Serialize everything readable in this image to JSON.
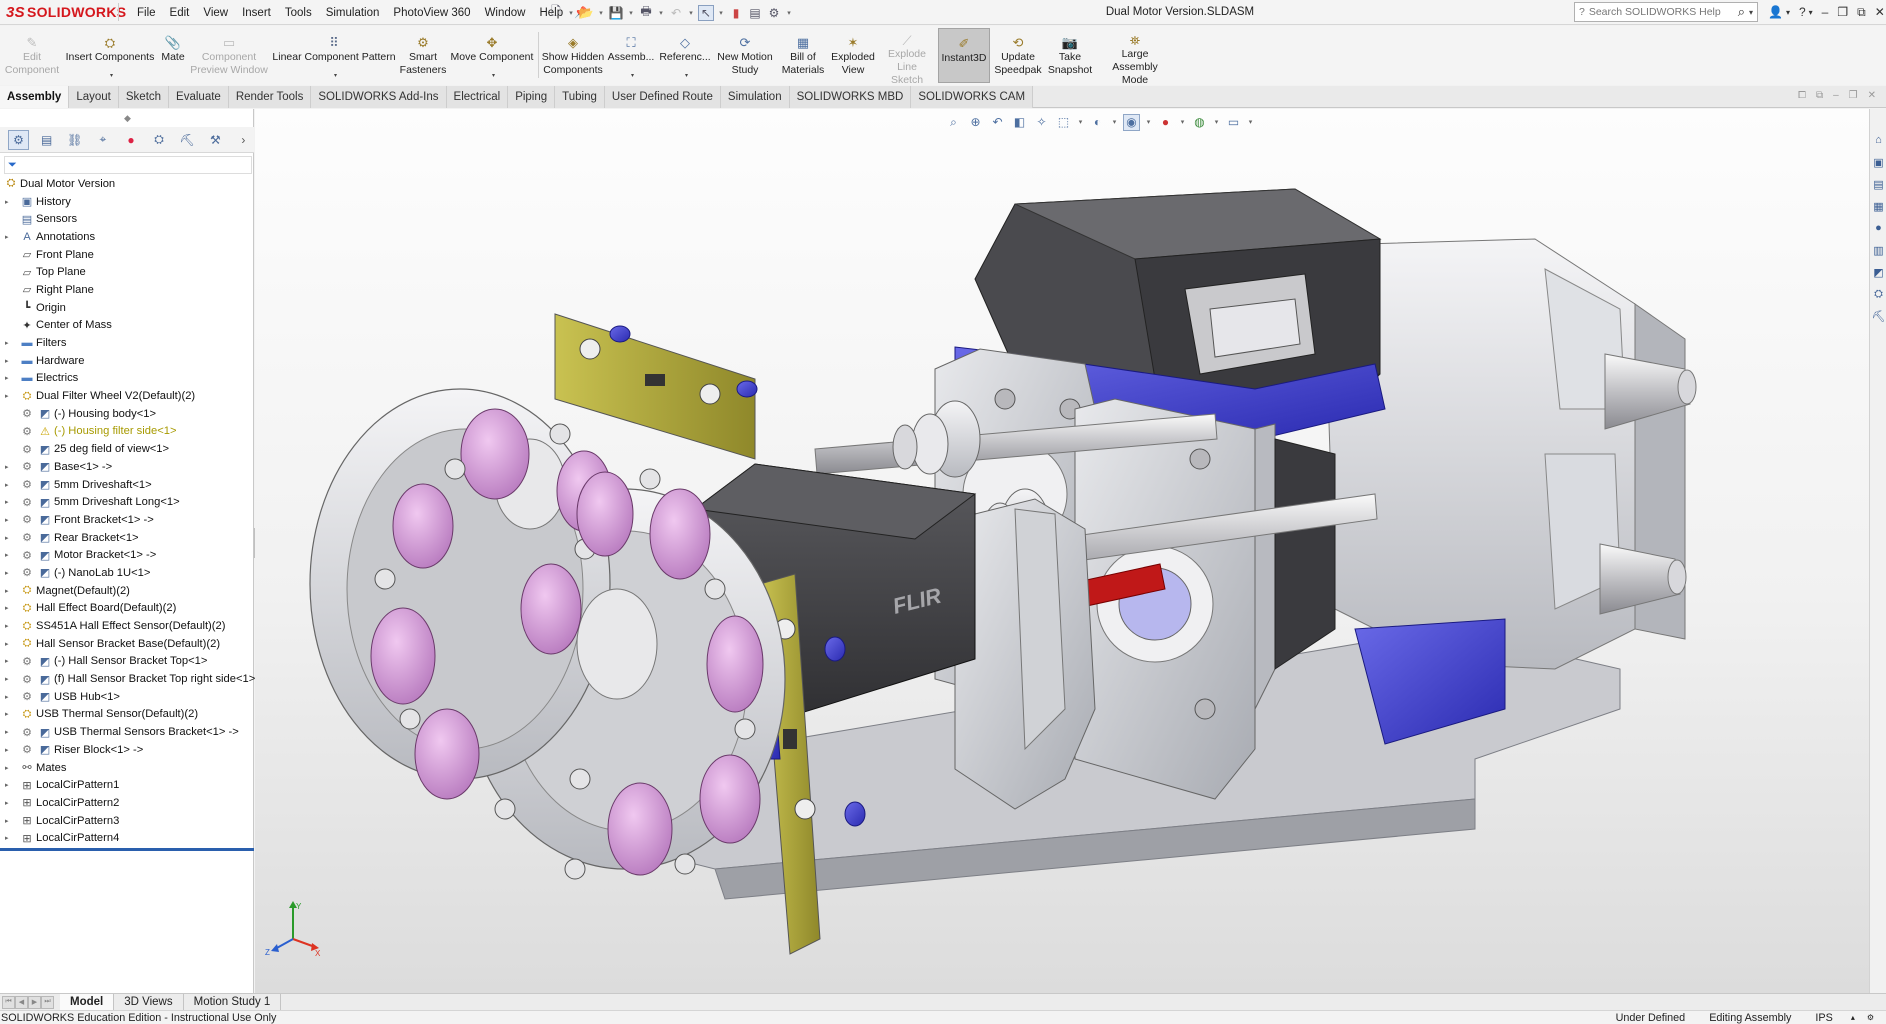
{
  "app": {
    "logo_brand": "SOLIDWORKS",
    "logo_mark": "3S",
    "document_title": "Dual Motor Version.SLDASM"
  },
  "menu": [
    "File",
    "Edit",
    "View",
    "Insert",
    "Tools",
    "Simulation",
    "PhotoView 360",
    "Window",
    "Help"
  ],
  "search": {
    "placeholder": "Search SOLIDWORKS Help"
  },
  "command_manager": {
    "edit_component": "Edit\nComponent",
    "insert_components": "Insert Components",
    "mate": "Mate",
    "component_preview": "Component\nPreview Window",
    "linear_pattern": "Linear Component Pattern",
    "smart_fasteners": "Smart\nFasteners",
    "move_component": "Move Component",
    "show_hidden": "Show Hidden\nComponents",
    "assembly_features": "Assemb...",
    "reference_geometry": "Referenc...",
    "new_motion_study": "New Motion\nStudy",
    "bill_of_materials": "Bill of\nMaterials",
    "exploded_view": "Exploded\nView",
    "explode_line_sketch": "Explode\nLine Sketch",
    "instant3d": "Instant3D",
    "update_speedpak": "Update\nSpeedpak",
    "take_snapshot": "Take\nSnapshot",
    "large_assembly_mode": "Large Assembly\nMode"
  },
  "tabs": [
    "Assembly",
    "Layout",
    "Sketch",
    "Evaluate",
    "Render Tools",
    "SOLIDWORKS Add-Ins",
    "Electrical",
    "Piping",
    "Tubing",
    "User Defined Route",
    "Simulation",
    "SOLIDWORKS MBD",
    "SOLIDWORKS CAM"
  ],
  "active_tab": "Assembly",
  "tree": [
    {
      "label": "Dual Motor Version",
      "icon": "assembly-icon",
      "level": 0,
      "expand": false
    },
    {
      "label": "History",
      "icon": "history-icon",
      "level": 1,
      "expand": true
    },
    {
      "label": "Sensors",
      "icon": "sensors-icon",
      "level": 1,
      "expand": false
    },
    {
      "label": "Annotations",
      "icon": "annotations-icon",
      "level": 1,
      "expand": true
    },
    {
      "label": "Front Plane",
      "icon": "plane-icon",
      "level": 1,
      "expand": false
    },
    {
      "label": "Top Plane",
      "icon": "plane-icon",
      "level": 1,
      "expand": false
    },
    {
      "label": "Right Plane",
      "icon": "plane-icon",
      "level": 1,
      "expand": false
    },
    {
      "label": "Origin",
      "icon": "origin-icon",
      "level": 1,
      "expand": false
    },
    {
      "label": "Center of Mass",
      "icon": "center-of-mass-icon",
      "level": 1,
      "expand": false
    },
    {
      "label": "Filters",
      "icon": "folder-icon",
      "level": 1,
      "expand": true
    },
    {
      "label": "Hardware",
      "icon": "folder-icon",
      "level": 1,
      "expand": true
    },
    {
      "label": "Electrics",
      "icon": "folder-icon",
      "level": 1,
      "expand": true
    },
    {
      "label": "Dual Filter Wheel V2(Default)(2)",
      "icon": "subassembly-icon",
      "level": 1,
      "expand": true
    },
    {
      "label": "(-) Housing body<1>",
      "icon": "part-icon",
      "level": 2,
      "expand": false
    },
    {
      "label": "(-) Housing filter side<1>",
      "icon": "warning-icon",
      "level": 2,
      "expand": false,
      "warn": true
    },
    {
      "label": "25 deg field of view<1>",
      "icon": "part-icon",
      "level": 2,
      "expand": false
    },
    {
      "label": "Base<1> ->",
      "icon": "part-icon",
      "level": 2,
      "expand": true
    },
    {
      "label": "5mm Driveshaft<1>",
      "icon": "part-icon",
      "level": 2,
      "expand": true
    },
    {
      "label": "5mm Driveshaft Long<1>",
      "icon": "part-icon",
      "level": 2,
      "expand": true
    },
    {
      "label": "Front Bracket<1> ->",
      "icon": "part-icon",
      "level": 2,
      "expand": true
    },
    {
      "label": "Rear Bracket<1>",
      "icon": "part-icon",
      "level": 2,
      "expand": true
    },
    {
      "label": "Motor Bracket<1> ->",
      "icon": "part-icon",
      "level": 2,
      "expand": true
    },
    {
      "label": "(-) NanoLab 1U<1>",
      "icon": "part-icon",
      "level": 2,
      "expand": true
    },
    {
      "label": "Magnet(Default)(2)",
      "icon": "subassembly-icon",
      "level": 1,
      "expand": true
    },
    {
      "label": "Hall Effect Board(Default)(2)",
      "icon": "subassembly-icon",
      "level": 1,
      "expand": true
    },
    {
      "label": "SS451A Hall Effect Sensor(Default)(2)",
      "icon": "subassembly-icon",
      "level": 1,
      "expand": true
    },
    {
      "label": "Hall Sensor Bracket Base(Default)(2)",
      "icon": "subassembly-icon",
      "level": 1,
      "expand": true
    },
    {
      "label": "(-) Hall Sensor Bracket Top<1>",
      "icon": "part-icon",
      "level": 2,
      "expand": true
    },
    {
      "label": "(f) Hall Sensor Bracket Top right side<1>",
      "icon": "part-icon",
      "level": 2,
      "expand": true
    },
    {
      "label": "USB Hub<1>",
      "icon": "part-icon",
      "level": 2,
      "expand": true
    },
    {
      "label": "USB Thermal Sensor(Default)(2)",
      "icon": "subassembly-icon",
      "level": 1,
      "expand": true
    },
    {
      "label": "USB Thermal Sensors Bracket<1> ->",
      "icon": "part-icon",
      "level": 2,
      "expand": true
    },
    {
      "label": "Riser Block<1> ->",
      "icon": "part-icon",
      "level": 2,
      "expand": true
    },
    {
      "label": "Mates",
      "icon": "mates-icon",
      "level": 1,
      "expand": true
    },
    {
      "label": "LocalCirPattern1",
      "icon": "pattern-icon",
      "level": 1,
      "expand": true
    },
    {
      "label": "LocalCirPattern2",
      "icon": "pattern-icon",
      "level": 1,
      "expand": true
    },
    {
      "label": "LocalCirPattern3",
      "icon": "pattern-icon",
      "level": 1,
      "expand": true
    },
    {
      "label": "LocalCirPattern4",
      "icon": "pattern-icon",
      "level": 1,
      "expand": true
    }
  ],
  "model": {
    "camera_brand": "FLIR"
  },
  "bottom_tabs": [
    "Model",
    "3D Views",
    "Motion Study 1"
  ],
  "status": {
    "left": "SOLIDWORKS Education Edition - Instructional Use Only",
    "definition": "Under Defined",
    "mode": "Editing Assembly",
    "units": "IPS"
  },
  "colors": {
    "brand_red": "#d5171d",
    "selection_blue": "#2a5fad",
    "filter_magenta": "#d8a3d8",
    "bracket_yellow": "#b6ae3b",
    "motor_blue": "#4a4ad0"
  }
}
